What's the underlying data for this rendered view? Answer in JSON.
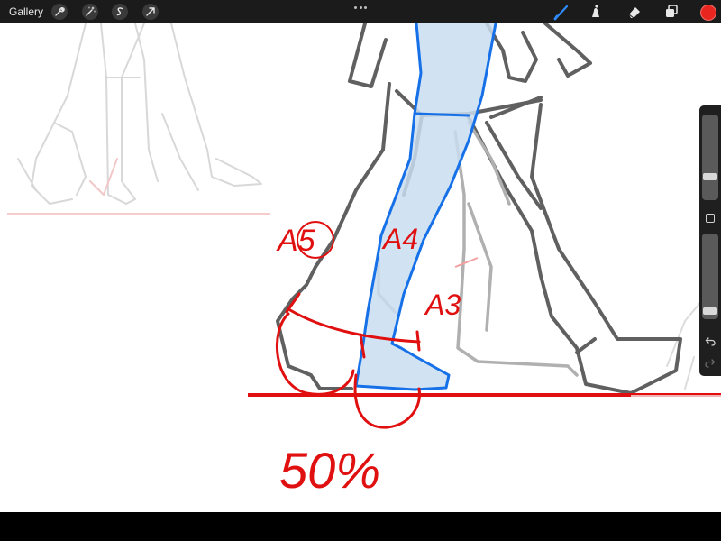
{
  "toolbar": {
    "gallery_label": "Gallery",
    "left_tools": [
      "wrench-icon",
      "magic-wand-icon",
      "selection-icon",
      "transform-arrow-icon"
    ],
    "right_tools": [
      "brush-icon",
      "smudge-icon",
      "eraser-icon",
      "layers-icon"
    ],
    "active_tool": "brush-icon",
    "current_color": "#e8261f"
  },
  "sidebar": {
    "brush_size_level": 0.25,
    "opacity_level": 0.06
  },
  "canvas": {
    "annotation_color": "#e01010",
    "highlight_color": "#1670e8",
    "labels": {
      "a5": "A5",
      "a4": "A4",
      "a3": "A3",
      "percent": "50%"
    }
  }
}
